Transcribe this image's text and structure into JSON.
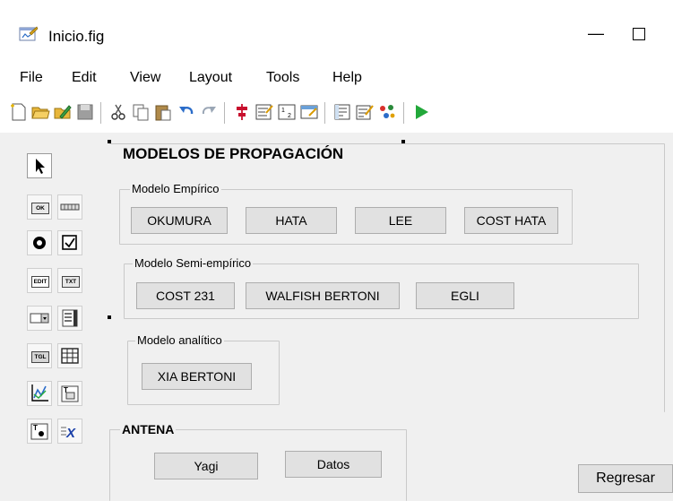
{
  "window": {
    "title": "Inicio.fig",
    "minimize_glyph": "—"
  },
  "menu": [
    "File",
    "Edit",
    "View",
    "Layout",
    "Tools",
    "Help"
  ],
  "toolbar": {
    "icons": [
      "new-file-icon",
      "open-folder-icon",
      "open-editor-icon",
      "save-icon",
      "cut-icon",
      "copy-icon",
      "paste-icon",
      "undo-icon",
      "redo-icon",
      "align-icon",
      "menu-editor-icon",
      "tab-order-icon",
      "toolbar-editor-icon",
      "editor-icon",
      "property-inspector-icon",
      "object-browser-icon",
      "run-icon"
    ]
  },
  "palette": {
    "items": [
      {
        "name": "select-tool-icon",
        "text": ""
      },
      {
        "name": "push-button-tool-icon",
        "text": "OK"
      },
      {
        "name": "slider-tool-icon",
        "text": ""
      },
      {
        "name": "radio-button-tool-icon",
        "text": ""
      },
      {
        "name": "checkbox-tool-icon",
        "text": ""
      },
      {
        "name": "edit-text-tool-icon",
        "text": "EDIT"
      },
      {
        "name": "static-text-tool-icon",
        "text": "TXT"
      },
      {
        "name": "popup-menu-tool-icon",
        "text": ""
      },
      {
        "name": "listbox-tool-icon",
        "text": ""
      },
      {
        "name": "toggle-button-tool-icon",
        "text": "TGL"
      },
      {
        "name": "table-tool-icon",
        "text": ""
      },
      {
        "name": "axes-tool-icon",
        "text": ""
      },
      {
        "name": "panel-tool-icon",
        "text": ""
      },
      {
        "name": "button-group-tool-icon",
        "text": ""
      },
      {
        "name": "activex-tool-icon",
        "text": ""
      }
    ]
  },
  "main_panel": {
    "title": "MODELOS DE PROPAGACIÓN",
    "empirico": {
      "title": "Modelo Empírico",
      "buttons": [
        "OKUMURA",
        "HATA",
        "LEE",
        "COST HATA"
      ]
    },
    "semi_empirico": {
      "title": "Modelo Semi-empírico",
      "buttons": [
        "COST 231",
        "WALFISH BERTONI",
        "EGLI"
      ]
    },
    "analitico": {
      "title": "Modelo analítico",
      "buttons": [
        "XIA BERTONI"
      ]
    }
  },
  "antena_panel": {
    "title": "ANTENA",
    "buttons": [
      "Yagi",
      "Datos"
    ]
  },
  "regresar_button": "Regresar",
  "colors": {
    "button_face": "#e1e1e1",
    "button_border": "#adadad",
    "background": "#f0f0f0",
    "run_green": "#22a83a"
  }
}
